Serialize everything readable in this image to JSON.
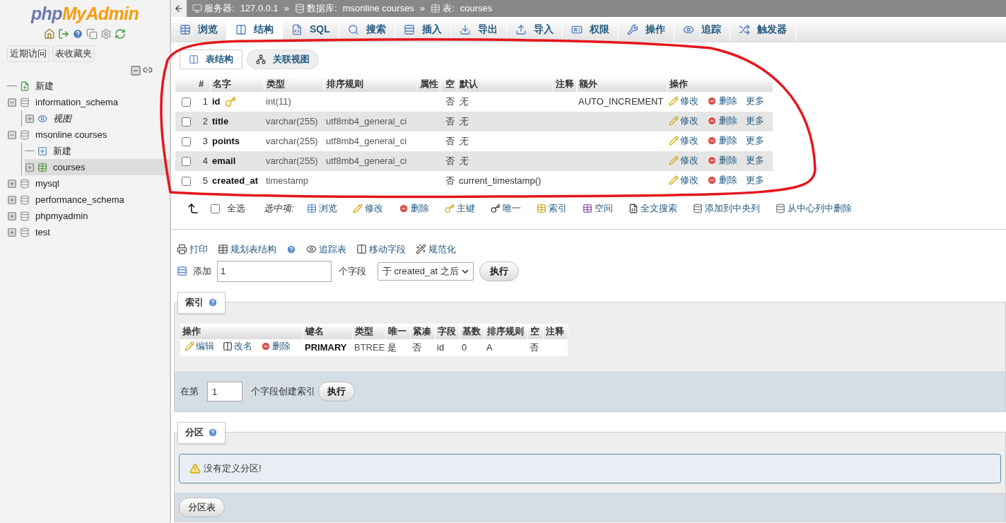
{
  "sidebar": {
    "logo": {
      "php": "php",
      "myadmin": "MyAdmin"
    },
    "buttons": [
      "近期访问",
      "表收藏夹"
    ],
    "tree": [
      {
        "kind": "new",
        "label": "新建",
        "selected": false
      },
      {
        "kind": "database",
        "label": "information_schema",
        "expanded": true,
        "selected": false,
        "children": [
          {
            "kind": "views",
            "label": "视图",
            "expanded": false,
            "selected": false
          }
        ]
      },
      {
        "kind": "database",
        "label": "msonline courses",
        "expanded": true,
        "selected": false,
        "children": [
          {
            "kind": "new-table",
            "label": "新建",
            "selected": false
          },
          {
            "kind": "table",
            "label": "courses",
            "expanded": false,
            "selected": true
          }
        ]
      },
      {
        "kind": "database",
        "label": "mysql",
        "expanded": false,
        "selected": false
      },
      {
        "kind": "database",
        "label": "performance_schema",
        "expanded": false,
        "selected": false
      },
      {
        "kind": "database",
        "label": "phpmyadmin",
        "expanded": false,
        "selected": false
      },
      {
        "kind": "database",
        "label": "test",
        "expanded": false,
        "selected": false
      }
    ]
  },
  "breadcrumb": {
    "separator": "»",
    "items": [
      {
        "kind": "server",
        "label": "服务器:",
        "value": "127.0.0.1"
      },
      {
        "kind": "database",
        "label": "数据库:",
        "value": "msonline courses"
      },
      {
        "kind": "table",
        "label": "表:",
        "value": "courses"
      }
    ]
  },
  "tabs": [
    {
      "label": "浏览",
      "selected": false
    },
    {
      "label": "结构",
      "selected": true
    },
    {
      "label": "SQL",
      "selected": false
    },
    {
      "label": "搜索",
      "selected": false
    },
    {
      "label": "插入",
      "selected": false
    },
    {
      "label": "导出",
      "selected": false
    },
    {
      "label": "导入",
      "selected": false
    },
    {
      "label": "权限",
      "selected": false
    },
    {
      "label": "操作",
      "selected": false
    },
    {
      "label": "追踪",
      "selected": false
    },
    {
      "label": "触发器",
      "selected": false
    }
  ],
  "subtabs": [
    {
      "label": "表结构",
      "selected": true
    },
    {
      "label": "关联视图",
      "selected": false
    }
  ],
  "structure": {
    "headers": [
      "#",
      "名字",
      "类型",
      "排序规则",
      "属性",
      "空",
      "默认",
      "注释",
      "额外",
      "操作"
    ],
    "rows": [
      {
        "checked": false,
        "num": "1",
        "name": "id",
        "primary_key": true,
        "type": "int(11)",
        "collation": "",
        "null": "否",
        "default": "无",
        "default_none": true,
        "extra": "AUTO_INCREMENT",
        "actions": [
          "修改",
          "删除",
          "更多"
        ]
      },
      {
        "checked": false,
        "num": "2",
        "name": "title",
        "primary_key": false,
        "type": "varchar(255)",
        "collation": "utf8mb4_general_ci",
        "null": "否",
        "default": "无",
        "default_none": true,
        "extra": "",
        "actions": [
          "修改",
          "删除",
          "更多"
        ]
      },
      {
        "checked": false,
        "num": "3",
        "name": "points",
        "primary_key": false,
        "type": "varchar(255)",
        "collation": "utf8mb4_general_ci",
        "null": "否",
        "default": "无",
        "default_none": true,
        "extra": "",
        "actions": [
          "修改",
          "删除",
          "更多"
        ]
      },
      {
        "checked": false,
        "num": "4",
        "name": "email",
        "primary_key": false,
        "type": "varchar(255)",
        "collation": "utf8mb4_general_ci",
        "null": "否",
        "default": "无",
        "default_none": true,
        "extra": "",
        "actions": [
          "修改",
          "删除",
          "更多"
        ]
      },
      {
        "checked": false,
        "num": "5",
        "name": "created_at",
        "primary_key": false,
        "type": "timestamp",
        "collation": "",
        "null": "否",
        "default": "current_timestamp()",
        "default_none": false,
        "extra": "",
        "actions": [
          "修改",
          "删除",
          "更多"
        ]
      }
    ]
  },
  "bulk": {
    "select_all": "全选",
    "select_all_checked": false,
    "with_selected": "选中项:",
    "actions": [
      "浏览",
      "修改",
      "删除",
      "主键",
      "唯一",
      "索引",
      "空间",
      "全文搜索",
      "添加到中央列",
      "从中心列中删除"
    ]
  },
  "tools": [
    "打印",
    "规划表结构",
    "追踪表",
    "移动字段",
    "规范化"
  ],
  "add_fields": {
    "label": "添加",
    "value": "1",
    "unit": "个字段",
    "position": "于 created_at 之后",
    "button": "执行"
  },
  "indexes": {
    "title": "索引",
    "headers": [
      "操作",
      "键名",
      "类型",
      "唯一",
      "紧凑",
      "字段",
      "基数",
      "排序规则",
      "空",
      "注释"
    ],
    "rows": [
      {
        "actions": [
          "编辑",
          "改名",
          "删除"
        ],
        "key_name": "PRIMARY",
        "type": "BTREE",
        "unique": "是",
        "packed": "否",
        "column": "id",
        "cardinality": "0",
        "collation": "A",
        "null": "否"
      }
    ],
    "create": {
      "prefix": "在第",
      "value": "1",
      "suffix": "个字段创建索引",
      "button": "执行"
    }
  },
  "partitions": {
    "title": "分区",
    "notice": "没有定义分区!",
    "button": "分区表"
  }
}
